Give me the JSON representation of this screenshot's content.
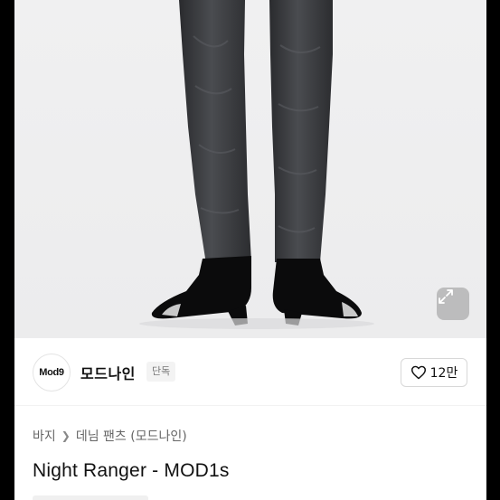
{
  "colors": {
    "background": "#ffffff",
    "frame_outer": "#000000",
    "text_primary": "#111111",
    "text_secondary": "#666666"
  },
  "hero": {
    "expand_icon": "expand-arrows-icon"
  },
  "brand": {
    "logo_text": "Mod9",
    "name": "모드나인",
    "tag": "단독",
    "like_icon": "heart-outline-icon",
    "like_count": "12만"
  },
  "breadcrumb": {
    "items": [
      "바지",
      "데님 팬츠 (모드나인)"
    ],
    "separator_icon": "chevron-right-icon"
  },
  "product": {
    "title": "Night Ranger - MOD1s"
  }
}
